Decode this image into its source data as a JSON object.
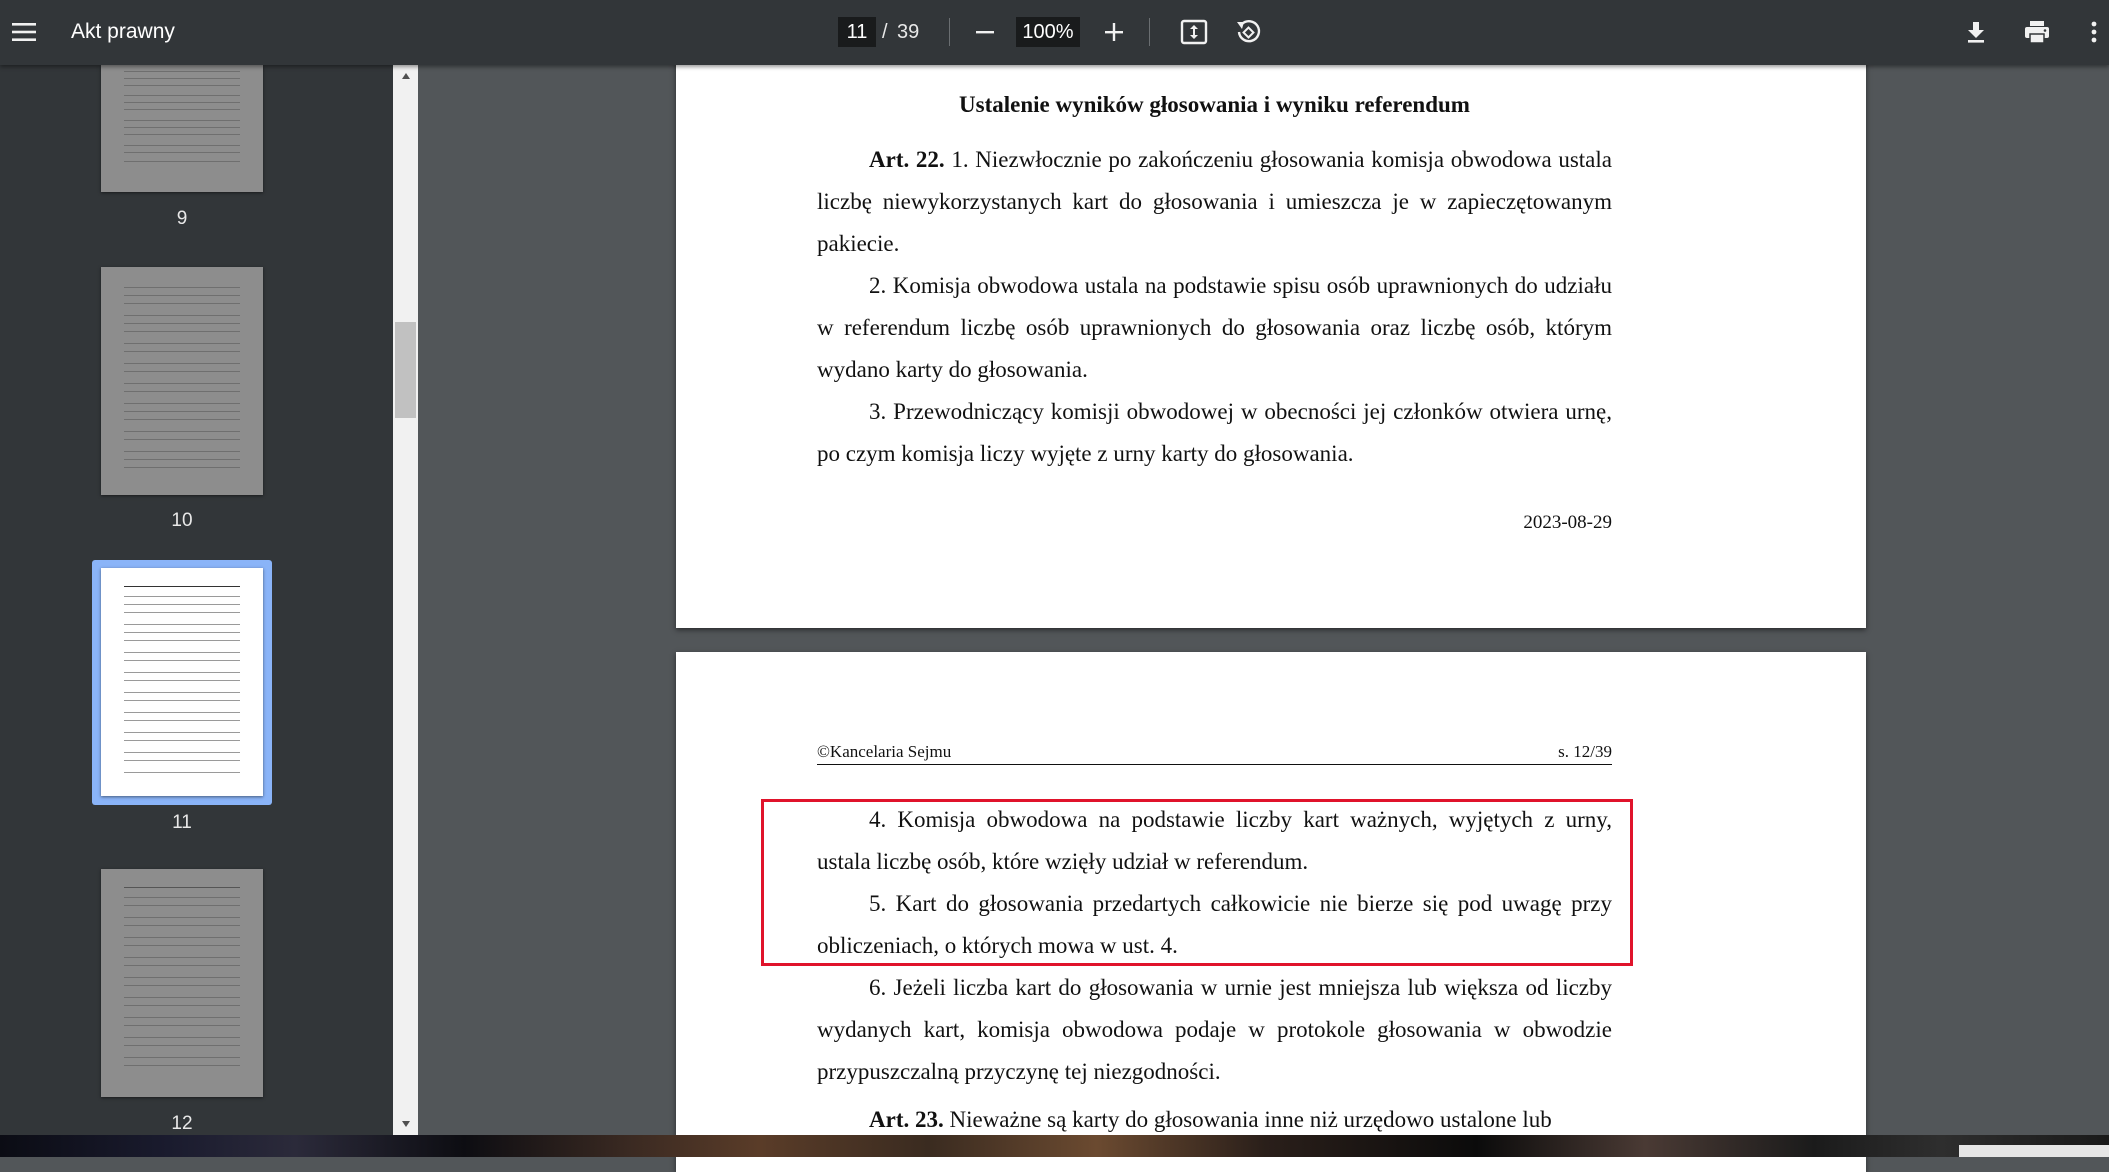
{
  "toolbar": {
    "title": "Akt prawny",
    "current_page": "11",
    "page_separator": "/",
    "total_pages": "39",
    "zoom": "100%",
    "icons": [
      "menu-icon",
      "minus-icon",
      "plus-icon",
      "fit-page-icon",
      "rotate-icon",
      "download-icon",
      "print-icon",
      "more-vert-icon"
    ]
  },
  "sidebar": {
    "thumbnails": [
      {
        "number": "9"
      },
      {
        "number": "10"
      },
      {
        "number": "11",
        "selected": true
      },
      {
        "number": "12"
      }
    ]
  },
  "page1": {
    "heading": "Ustalenie wyników głosowania i wyniku referendum",
    "p1_art": "Art. 22.",
    "p1_text": " 1. Niezwłocznie po zakończeniu głosowania komisja obwodowa ustala liczbę niewykorzystanych kart do głosowania i umieszcza je w zapieczętowanym pakiecie.",
    "p2": "2. Komisja obwodowa ustala na podstawie spisu osób uprawnionych do udziału w referendum liczbę osób uprawnionych do głosowania oraz liczbę osób, którym wydano karty do głosowania.",
    "p3": "3. Przewodniczący komisji obwodowej w obecności jej członków otwiera urnę, po czym komisja liczy wyjęte z urny karty do głosowania.",
    "date": "2023-08-29"
  },
  "page2": {
    "footer_left": "©Kancelaria Sejmu",
    "footer_right": "s. 12/39",
    "p4": "4. Komisja obwodowa na podstawie liczby kart ważnych, wyjętych z urny, ustala liczbę osób, które wzięły udział w referendum.",
    "p5": "5. Kart do głosowania przedartych całkowicie nie bierze się pod uwagę przy obliczeniach, o których mowa w ust. 4.",
    "p6": "6. Jeżeli liczba kart do głosowania w urnie jest mniejsza lub większa od liczby wydanych kart, komisja obwodowa podaje w protokole głosowania w obwodzie przypuszczalną przyczynę tej niezgodności.",
    "p7_art": "Art. 23.",
    "p7_text": " Nieważne są karty do głosowania inne niż urzędowo ustalone lub"
  },
  "colors": {
    "toolbar_bg": "#323639",
    "viewer_bg": "#525659",
    "selected_thumb": "#8ab4f8",
    "highlight_border": "#e0132b"
  }
}
